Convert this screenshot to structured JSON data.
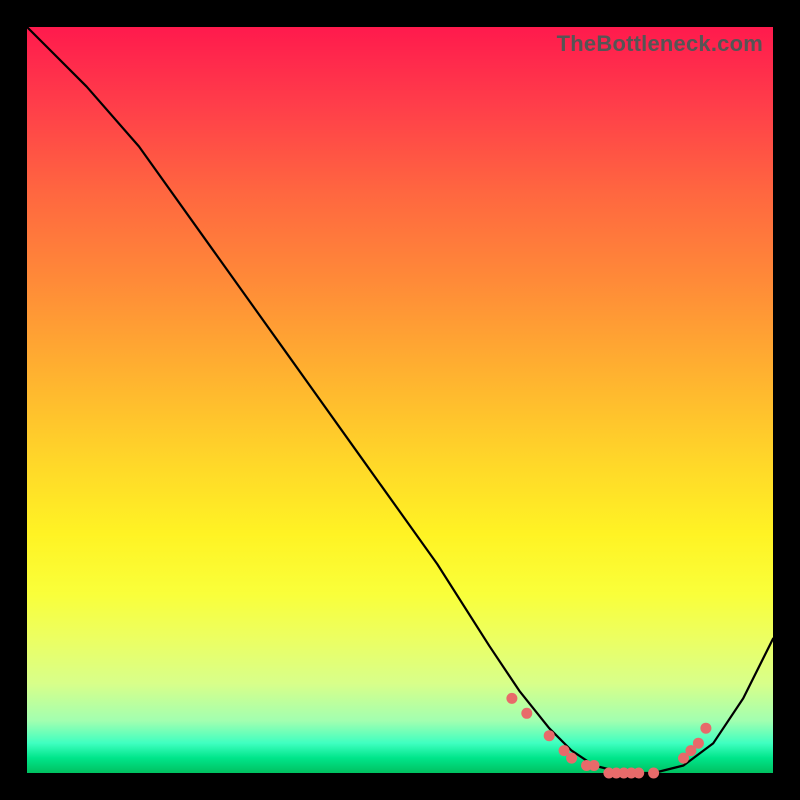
{
  "watermark": "TheBottleneck.com",
  "colors": {
    "dot": "#e86a6a",
    "curve": "#000000"
  },
  "chart_data": {
    "type": "line",
    "title": "",
    "xlabel": "",
    "ylabel": "",
    "xlim": [
      0,
      100
    ],
    "ylim": [
      0,
      100
    ],
    "grid": false,
    "legend": false,
    "background": "vertical-gradient red→yellow→green",
    "series": [
      {
        "name": "bottleneck-curve",
        "x": [
          0,
          3,
          8,
          15,
          25,
          35,
          45,
          55,
          62,
          66,
          70,
          73,
          76,
          80,
          84,
          88,
          92,
          96,
          100
        ],
        "y": [
          100,
          97,
          92,
          84,
          70,
          56,
          42,
          28,
          17,
          11,
          6,
          3,
          1,
          0,
          0,
          1,
          4,
          10,
          18
        ]
      }
    ],
    "marker_points": {
      "name": "highlighted-dots",
      "x": [
        65,
        67,
        70,
        72,
        73,
        75,
        76,
        78,
        79,
        80,
        81,
        82,
        84,
        88,
        89,
        90,
        91
      ],
      "y": [
        10,
        8,
        5,
        3,
        2,
        1,
        1,
        0,
        0,
        0,
        0,
        0,
        0,
        2,
        3,
        4,
        6
      ]
    }
  }
}
